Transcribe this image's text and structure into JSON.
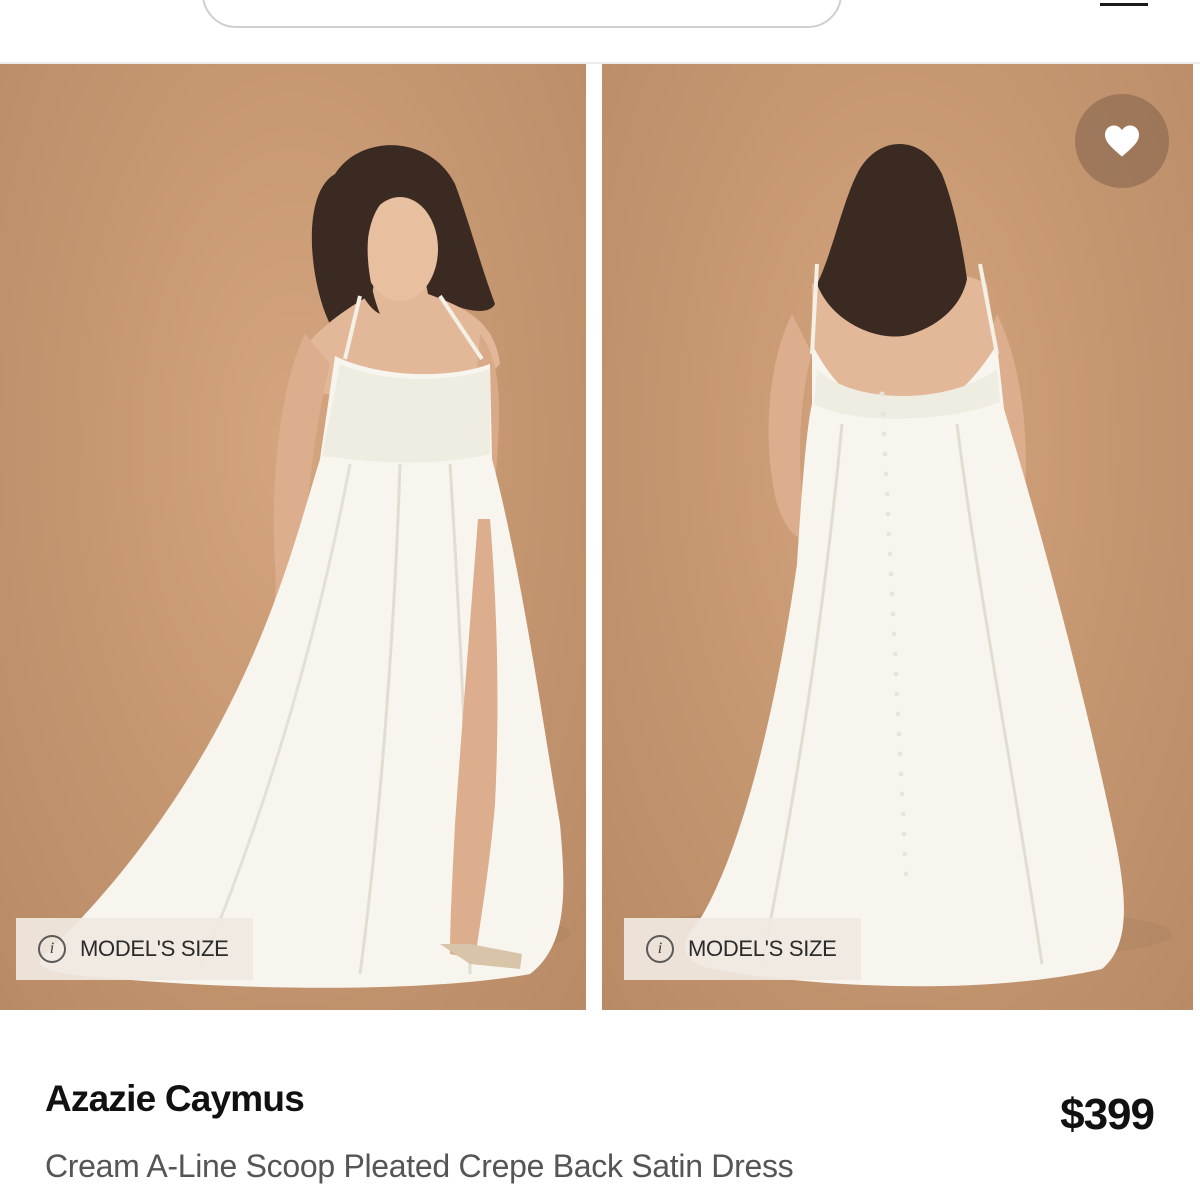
{
  "header": {
    "search_icon": "search-icon",
    "menu_icon": "hamburger-menu-icon"
  },
  "gallery": {
    "images": [
      {
        "alt": "Model in cream A-line dress, front view",
        "badge_icon": "info-icon",
        "badge_label": "MODEL'S SIZE"
      },
      {
        "alt": "Model in cream A-line dress, back view",
        "badge_icon": "info-icon",
        "badge_label": "MODEL'S SIZE"
      }
    ],
    "favorite_icon": "heart-icon",
    "info_glyph": "i"
  },
  "product": {
    "brand": "Azazie Caymus",
    "description": "Cream A-Line Scoop Pleated Crepe Back Satin Dress",
    "price": "$399"
  },
  "colors": {
    "backdrop": "#c49670",
    "dress": "#f7f5ee",
    "hair": "#3a2a22",
    "skin": "#e3b899",
    "text_primary": "#111111",
    "text_secondary": "#555555"
  }
}
